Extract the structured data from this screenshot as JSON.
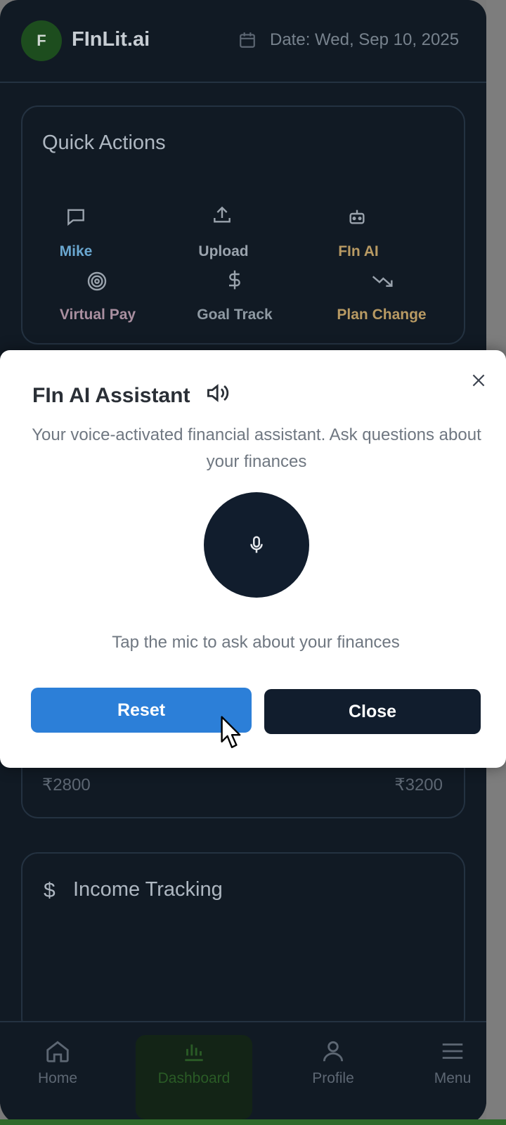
{
  "header": {
    "avatar_letter": "F",
    "brand": "FInLit.ai",
    "date": "Date: Wed, Sep 10, 2025"
  },
  "quick_actions": {
    "title": "Quick Actions",
    "items": [
      {
        "label": "Mike",
        "icon": "chat-icon",
        "color": "#6aa7d0"
      },
      {
        "label": "Upload",
        "icon": "upload-icon",
        "color": "#9aa3ad"
      },
      {
        "label": "FIn AI",
        "icon": "bot-icon",
        "color": "#b89a63"
      },
      {
        "label": "Virtual Pay",
        "icon": "target-icon",
        "color": "#a98fa0"
      },
      {
        "label": "Goal Track",
        "icon": "dollar-icon",
        "color": "#8f9aa3"
      },
      {
        "label": "Plan Change",
        "icon": "trend-down-icon",
        "color": "#b89a63"
      }
    ]
  },
  "budget": {
    "left_value": "₹2800",
    "right_value": "₹3200"
  },
  "income": {
    "title": "Income Tracking",
    "icon": "$"
  },
  "modal": {
    "title": "FIn AI Assistant",
    "description": "Your voice-activated financial assistant. Ask questions about your finances",
    "hint": "Tap the mic to ask about your finances",
    "reset_label": "Reset",
    "close_label": "Close"
  },
  "nav": {
    "items": [
      {
        "label": "Home",
        "icon": "home-icon"
      },
      {
        "label": "Dashboard",
        "icon": "bar-chart-icon",
        "active": true
      },
      {
        "label": "Profile",
        "icon": "user-icon"
      },
      {
        "label": "Menu",
        "icon": "menu-icon"
      }
    ]
  },
  "colors": {
    "background": "#111a24",
    "card_border": "#243241",
    "primary": "#2c7fd8",
    "dark_button": "#111d2d",
    "active_nav": "#2a5b26"
  }
}
